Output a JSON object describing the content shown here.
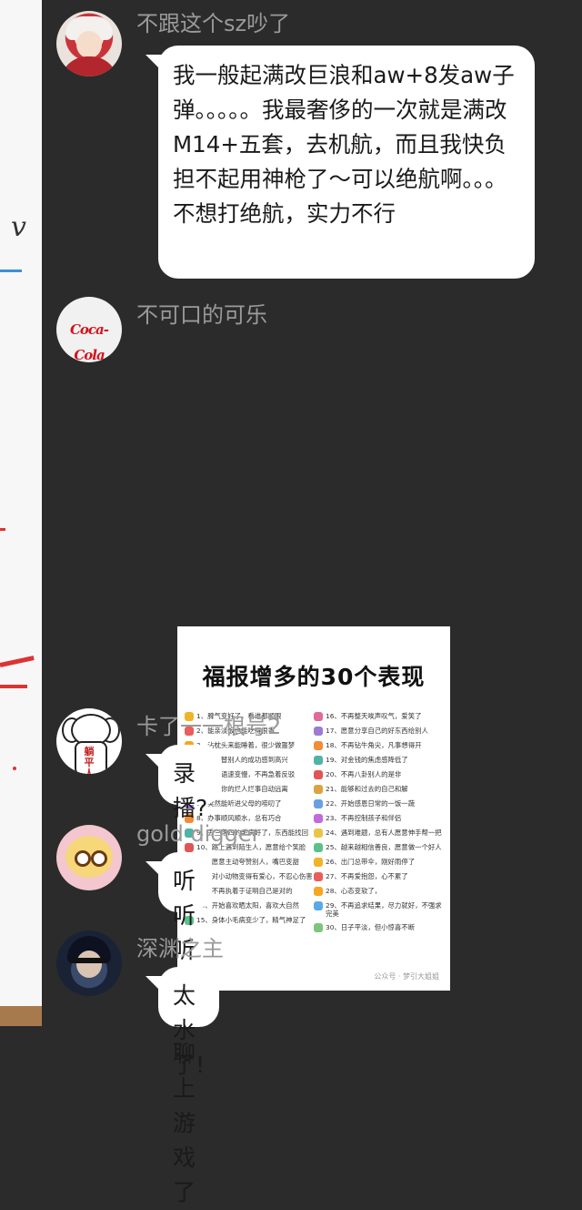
{
  "messages": [
    {
      "sender": "不跟这个sz吵了",
      "text": "我一般起满改巨浪和aw+8发aw子弹。。。。。我最奢侈的一次就是满改M14+五套，去机航，而且我快负担不起用神枪了～可以绝航啊。。。不想打绝航，实力不行"
    },
    {
      "sender": "不可口的可乐",
      "avatar_text": "Coca-Cola",
      "image": {
        "title": "福报增多的30个表现",
        "left_items": [
          "1、脾气变好了，看谁都顺眼",
          "2、能亲淡饭也能吃得很香",
          "3、沾枕头来能睡着，很少做噩梦",
          "4、真心替别人的成功感到高兴",
          "5、说话语速变慢，不再急着反驳",
          "6、消耗你的烂人烂事自动远离",
          "7、突然能听进父母的唠叨了",
          "8、办事顺风顺水，总有巧合",
          "9、丢三落四的毛病好了，东西能找回",
          "10、路上遇到陌生人，愿意给个笑脸",
          "11、愿意主动夸赞别人，嘴巴变甜",
          "12、对小动物变得有爱心，不忍心伤害",
          "13、不再执着于证明自己是对的",
          "14、开始喜欢晒太阳，喜欢大自然",
          "15、身体小毛病变少了，精气神足了"
        ],
        "right_items": [
          "16、不再整天唉声叹气，爱笑了",
          "17、愿意分享自己的好东西给别人",
          "18、不再钻牛角尖，凡事想得开",
          "19、对金钱的焦虑感降低了",
          "20、不再八卦别人的是非",
          "21、能够和过去的自己和解",
          "22、开始感恩日常的一饭一蔬",
          "23、不再控制孩子和伴侣",
          "24、遇到难题，总有人愿意伸手帮一把",
          "25、越来越相信善良，愿意做一个好人",
          "26、出门总带伞，刚好雨停了",
          "27、不再爱抱怨，心不累了",
          "28、心态变软了，",
          "29、不再追求结果，尽力就好，不强求完美",
          "30、日子平淡，但小惊喜不断"
        ],
        "footer": "公众号 · 梦引大姐姐"
      }
    },
    {
      "sender": "卡了一一根号2",
      "avatar_text": "躺平人",
      "text": "录播?"
    },
    {
      "sender": "gold digger",
      "text": "听听听咋还聊上游戏了"
    },
    {
      "sender": "深渊之主",
      "text": "太水了!"
    }
  ],
  "left_strip": {
    "glyph": "v"
  },
  "icon_colors": [
    "#f0b429",
    "#e85d5d",
    "#f5a623",
    "#5aa9e6",
    "#7bc67b",
    "#e06b9a",
    "#9b7bd4",
    "#f28c38",
    "#4fb3a5",
    "#e05555",
    "#d9a441",
    "#6aa0e0",
    "#c46ad9",
    "#e8c547",
    "#5cc08a"
  ]
}
